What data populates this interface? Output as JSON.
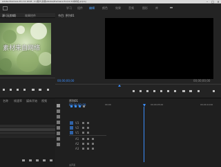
{
  "title_bar": {
    "text": "Adobe Premiere Pro CC 2018 - C:\\用户\\文档\\Adobe\\Premiere Pro\\12.0\\未命名.prproj",
    "controls": [
      "–",
      "□",
      "×"
    ]
  },
  "workspace_tabs": [
    "学习",
    "组件",
    "编辑",
    "颜色",
    "效果",
    "音频",
    "图形",
    "库"
  ],
  "active_workspace_index": 2,
  "source_monitor": {
    "tabs": [
      "源:(无剪辑)",
      "效果控件"
    ],
    "watermark_text": "素材来自网络"
  },
  "program_monitor": {
    "title": "节目: 序列01",
    "timecode_left": "00;00;00;00",
    "timecode_right": "00;00;00;00"
  },
  "project_panel": {
    "columns": [
      "名称",
      "帧速率",
      "媒体开始",
      "视频"
    ],
    "rows": [
      "",
      "",
      "",
      ""
    ]
  },
  "timeline": {
    "title": "序列01",
    "timecode": "00;00;00;00",
    "ruler_labels": [
      "00;00",
      "00;00;05;00",
      "00;00;10;00"
    ],
    "tracks": [
      "V3",
      "V2",
      "V1",
      "A1",
      "A2",
      "A3"
    ],
    "footer_label": "主声道"
  },
  "colors": {
    "accent_blue": "#3c8fff",
    "panel_bg": "#232323",
    "program_video_bg": "#000000"
  }
}
